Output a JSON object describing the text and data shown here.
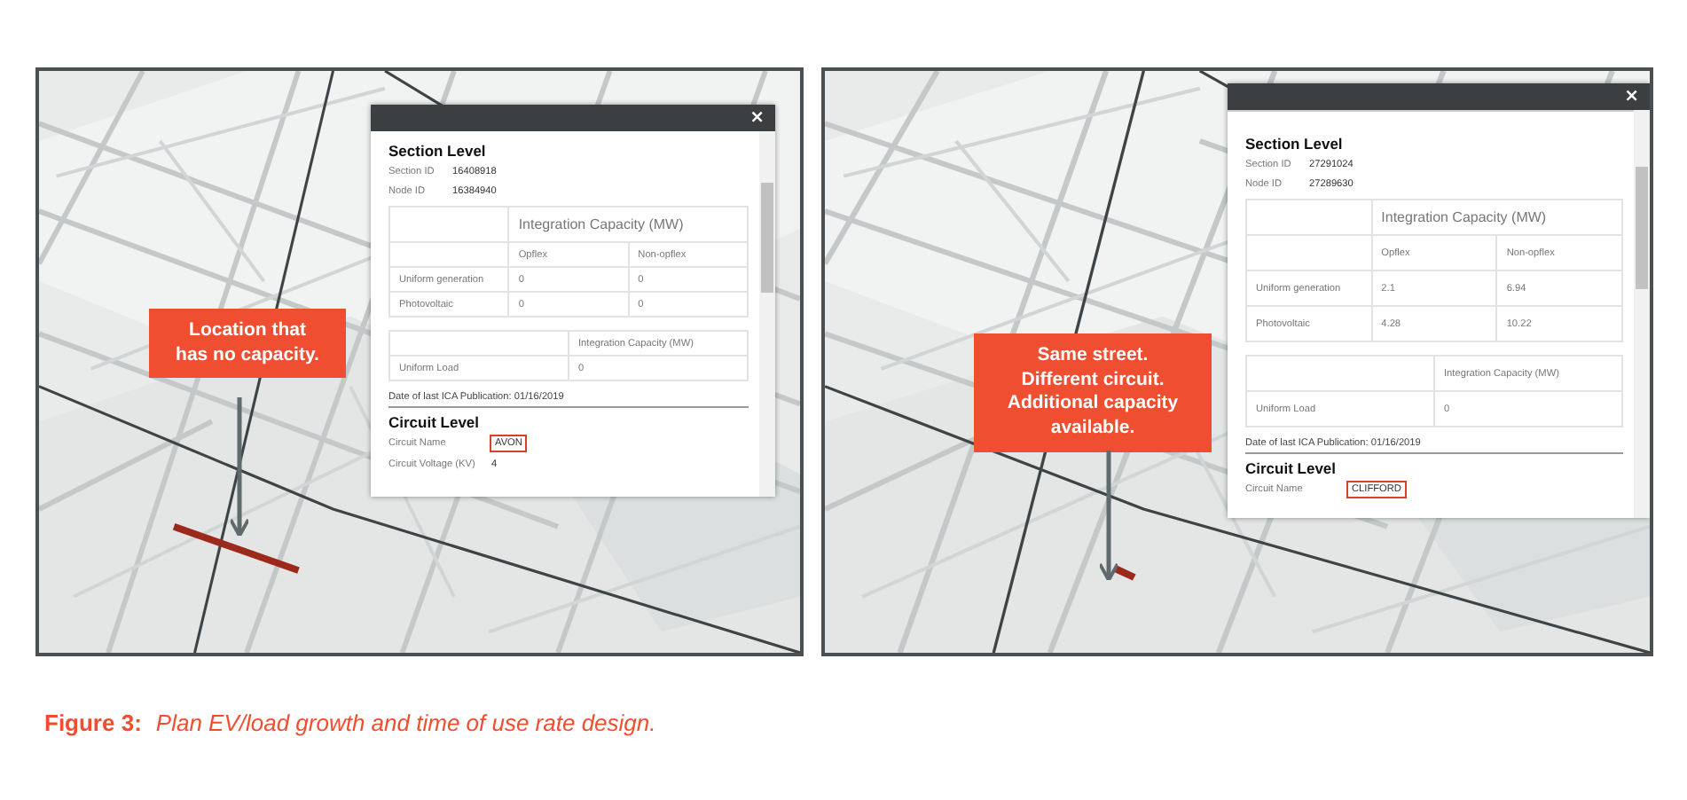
{
  "panels": [
    {
      "popup": {
        "close": "×",
        "section_title": "Section Level",
        "fields": [
          {
            "label": "Section ID",
            "value": "16408918"
          },
          {
            "label": "Node ID",
            "value": "16384940"
          }
        ],
        "gen_table": {
          "heading": "Integration Capacity (MW)",
          "columns": [
            "Opflex",
            "Non-opflex"
          ],
          "rows": [
            {
              "label": "Uniform generation",
              "values": [
                "0",
                "0"
              ]
            },
            {
              "label": "Photovoltaic",
              "values": [
                "0",
                "0"
              ]
            }
          ]
        },
        "load_table": {
          "heading": "Integration Capacity (MW)",
          "rows": [
            {
              "label": "Uniform Load",
              "value": "0"
            }
          ]
        },
        "publication": "Date of last ICA Publication: 01/16/2019",
        "circuit_title": "Circuit Level",
        "circuit_fields": [
          {
            "label": "Circuit Name",
            "value": "AVON",
            "highlighted": true
          },
          {
            "label": "Circuit Voltage (KV)",
            "value": "4",
            "highlighted": false
          }
        ]
      },
      "callout": "Location that\nhas no capacity."
    },
    {
      "popup": {
        "close": "×",
        "section_title": "Section Level",
        "fields": [
          {
            "label": "Section ID",
            "value": "27291024"
          },
          {
            "label": "Node ID",
            "value": "27289630"
          }
        ],
        "gen_table": {
          "heading": "Integration Capacity (MW)",
          "columns": [
            "Opflex",
            "Non-opflex"
          ],
          "rows": [
            {
              "label": "Uniform generation",
              "values": [
                "2.1",
                "6.94"
              ]
            },
            {
              "label": "Photovoltaic",
              "values": [
                "4.28",
                "10.22"
              ]
            }
          ]
        },
        "load_table": {
          "heading": "Integration Capacity (MW)",
          "rows": [
            {
              "label": "Uniform Load",
              "value": "0"
            }
          ]
        },
        "publication": "Date of last ICA Publication: 01/16/2019",
        "circuit_title": "Circuit Level",
        "circuit_fields": [
          {
            "label": "Circuit Name",
            "value": "CLIFFORD",
            "highlighted": true
          }
        ]
      },
      "callout": "Same street.\nDifferent circuit.\nAdditional capacity\navailable."
    }
  ],
  "caption": {
    "label": "Figure 3:",
    "text": "Plan EV/load growth and time of use rate design."
  }
}
